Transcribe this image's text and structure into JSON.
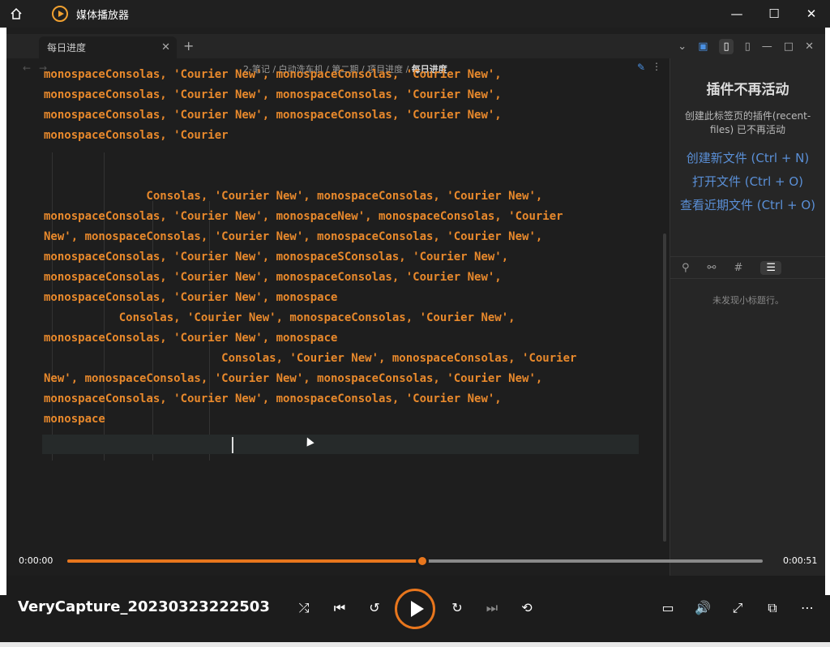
{
  "window": {
    "title": "媒体播放器",
    "icons": {
      "home": "home-icon",
      "app": "media-player-icon",
      "minimize": "minimize-icon",
      "maximize": "maximize-icon",
      "close": "close-icon"
    }
  },
  "note_app": {
    "tab_title": "每日进度",
    "breadcrumb": [
      "2-笔记",
      "白动洗车机",
      "第二期",
      "项目进度"
    ],
    "breadcrumb_current": "每日进度",
    "editor_lines": [
      "monospaceConsolas, 'Courier New', monospaceConsolas, 'Courier New',",
      "monospaceConsolas, 'Courier New', monospaceConsolas, 'Courier New',",
      "monospaceConsolas, 'Courier New', monospaceConsolas, 'Courier New',",
      "monospaceConsolas, 'Courier",
      "               Consolas, 'Courier New', monospaceConsolas, 'Courier New',",
      "monospaceConsolas, 'Courier New', monospaceNew', monospaceConsolas, 'Courier",
      "New', monospaceConsolas, 'Courier New', monospaceConsolas, 'Courier New',",
      "monospaceConsolas, 'Courier New', monospaceSConsolas, 'Courier New',",
      "monospaceConsolas, 'Courier New', monospaceConsolas, 'Courier New',",
      "monospaceConsolas, 'Courier New', monospace",
      "           Consolas, 'Courier New', monospaceConsolas, 'Courier New',",
      "monospaceConsolas, 'Courier New', monospace",
      "                          Consolas, 'Courier New', monospaceConsolas, 'Courier",
      "New', monospaceConsolas, 'Courier New', monospaceConsolas, 'Courier New',",
      "monospaceConsolas, 'Courier New', monospaceConsolas, 'Courier New',",
      "monospace"
    ],
    "sidebar": {
      "title": "插件不再活动",
      "description": "创建此标签页的插件(recent-files) 已不再活动",
      "links": [
        "创建新文件 (Ctrl + N)",
        "打开文件 (Ctrl + O)",
        "查看近期文件 (Ctrl + O)"
      ],
      "empty_text": "未发现小标题行。"
    }
  },
  "player": {
    "time_current": "0:00:00",
    "time_total": "0:00:51",
    "progress": 0.51,
    "filename": "VeryCapture_20230323222503",
    "accent_color": "#e8761d"
  }
}
